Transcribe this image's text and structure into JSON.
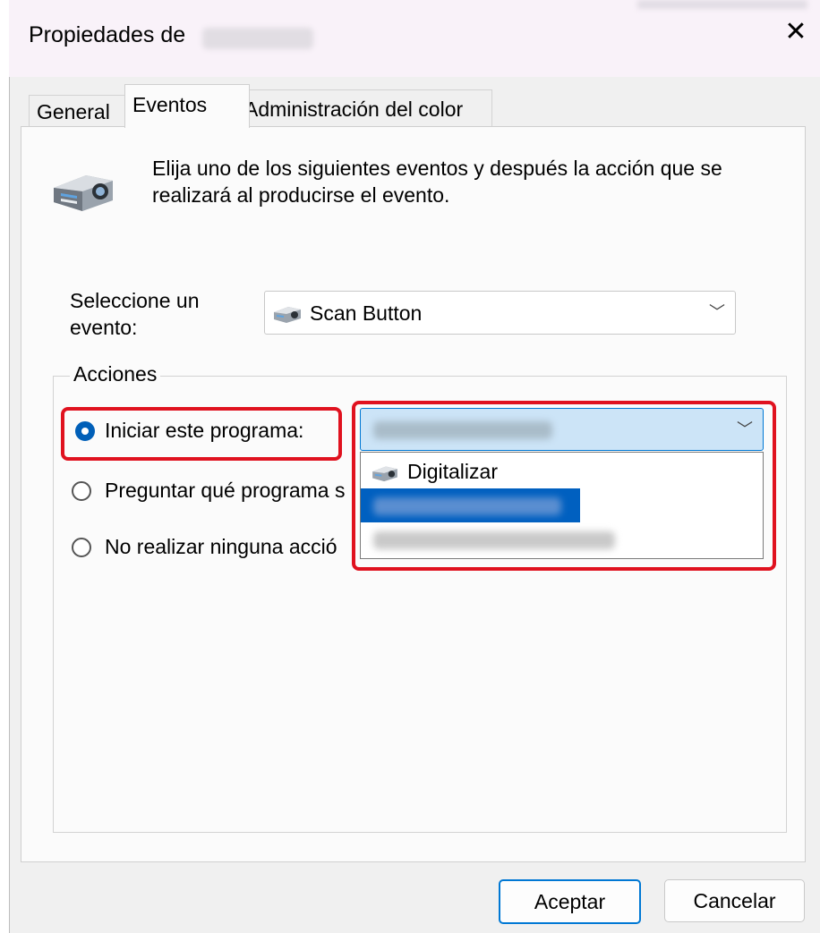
{
  "window": {
    "title": "Propiedades de",
    "close_glyph": "✕"
  },
  "tabs": [
    {
      "label": "General"
    },
    {
      "label": "Eventos"
    },
    {
      "label": "Administración del color"
    }
  ],
  "intro_text": "Elija uno de los siguientes eventos y después la acción que se realizará al producirse el evento.",
  "event": {
    "label": "Seleccione un evento:",
    "selected": "Scan Button"
  },
  "actions": {
    "legend": "Acciones",
    "options": [
      {
        "label": "Iniciar este programa:",
        "checked": true
      },
      {
        "label": "Preguntar qué programa s",
        "checked": false
      },
      {
        "label": "No realizar ninguna acció",
        "checked": false
      }
    ]
  },
  "program_dropdown": {
    "items": [
      {
        "label": "Digitalizar",
        "selected": false,
        "icon": "scanner-icon"
      },
      {
        "label": "",
        "selected": true,
        "icon": "app-icon"
      },
      {
        "label": "",
        "selected": false,
        "icon": "app-icon"
      }
    ]
  },
  "buttons": {
    "ok": "Aceptar",
    "cancel": "Cancelar"
  },
  "colors": {
    "highlight_red": "#e0121f",
    "accent_blue": "#0078d4",
    "selected_row": "#0060c0",
    "combo_bg": "#cce4f7"
  }
}
